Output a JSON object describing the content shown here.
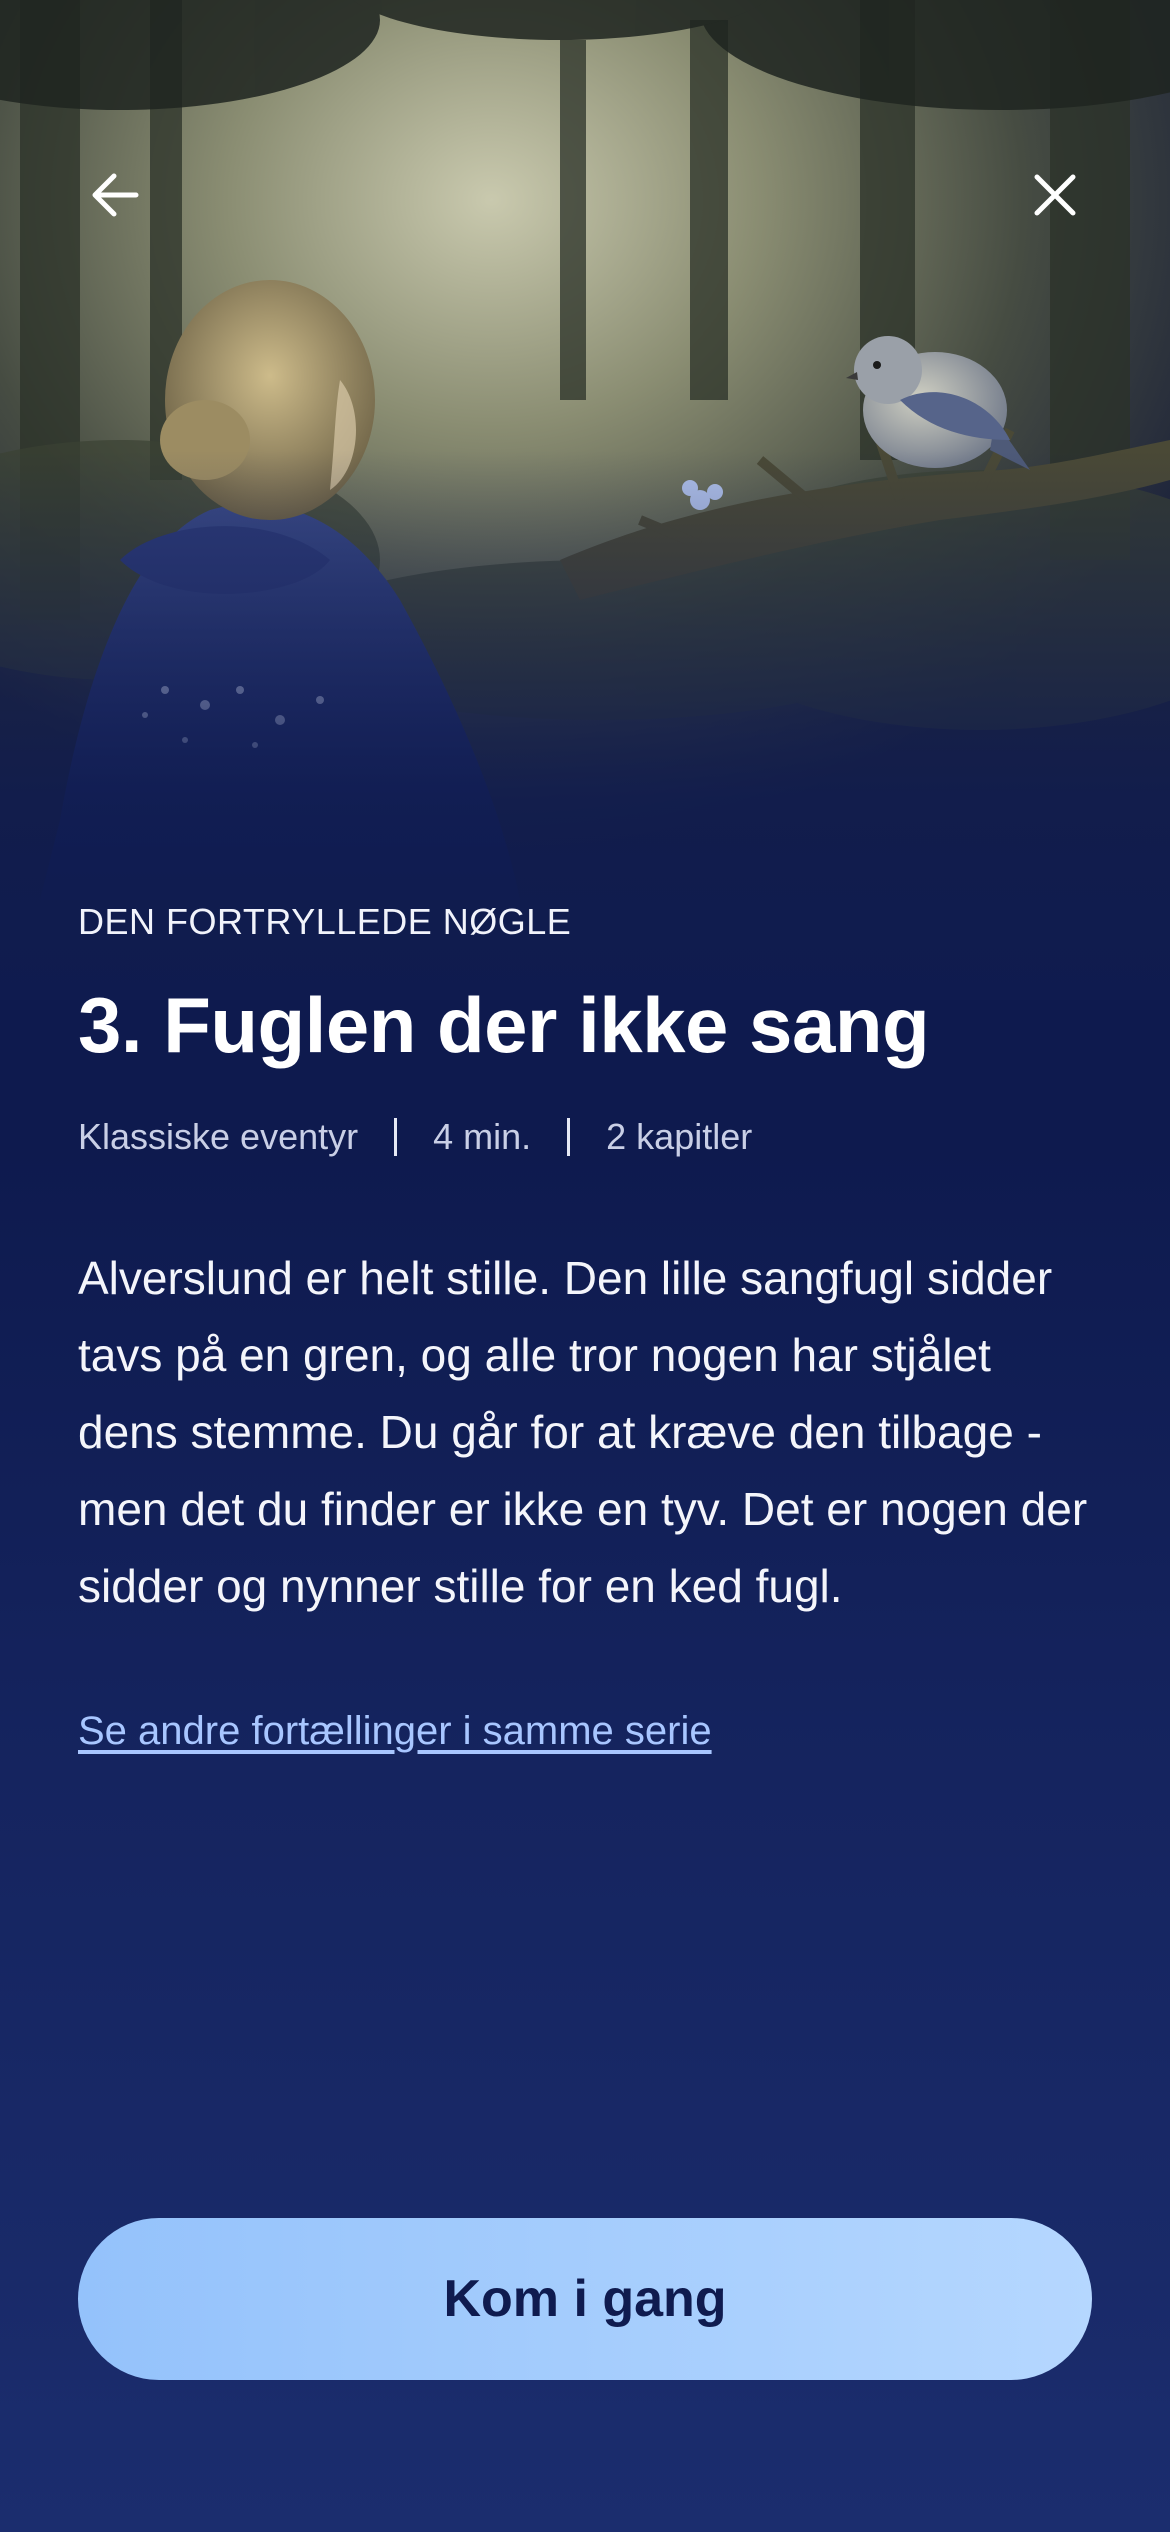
{
  "header": {
    "back_icon": "arrow-left-icon",
    "close_icon": "close-icon"
  },
  "story": {
    "series": "DEN FORTRYLLEDE NØGLE",
    "title": "3. Fuglen der ikke sang",
    "meta": {
      "category": "Klassiske eventyr",
      "duration": "4 min.",
      "chapters": "2 kapitler"
    },
    "description": "Alverslund er helt stille. Den lille sangfugl sidder tavs på en gren, og alle tror nogen har stjålet dens stemme. Du går for at kræve den tilbage - men det du finder er ikke en tyv. Det er nogen der sidder og nynner stille for en ked fugl.",
    "series_link": "Se andre fortællinger i samme serie"
  },
  "cta": {
    "label": "Kom i gang"
  },
  "colors": {
    "background": "#0f1b4f",
    "link": "#a8c6ff",
    "button": "#a6ccff",
    "button_text": "#0f1b4f"
  }
}
